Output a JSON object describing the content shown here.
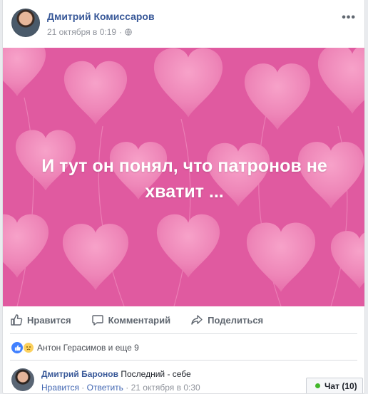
{
  "post": {
    "author": "Дмитрий Комиссаров",
    "date": "21 октября в 0:19",
    "privacy_icon": "globe-icon",
    "more_label": "•••",
    "image_text": "И тут он понял, что патронов не хватит ..."
  },
  "actions": {
    "like": "Нравится",
    "comment": "Комментарий",
    "share": "Поделиться"
  },
  "reactions": {
    "summary": "Антон Герасимов и еще 9"
  },
  "comment": {
    "author": "Дмитрий Баронов",
    "text": "Последний - себе",
    "like": "Нравится",
    "reply": "Ответить",
    "date": "21 октября в 0:30"
  },
  "chat": {
    "label": "Чат (10)"
  },
  "colors": {
    "accent": "#385898",
    "image_bg": "#e05aa0",
    "online": "#42b72a"
  }
}
